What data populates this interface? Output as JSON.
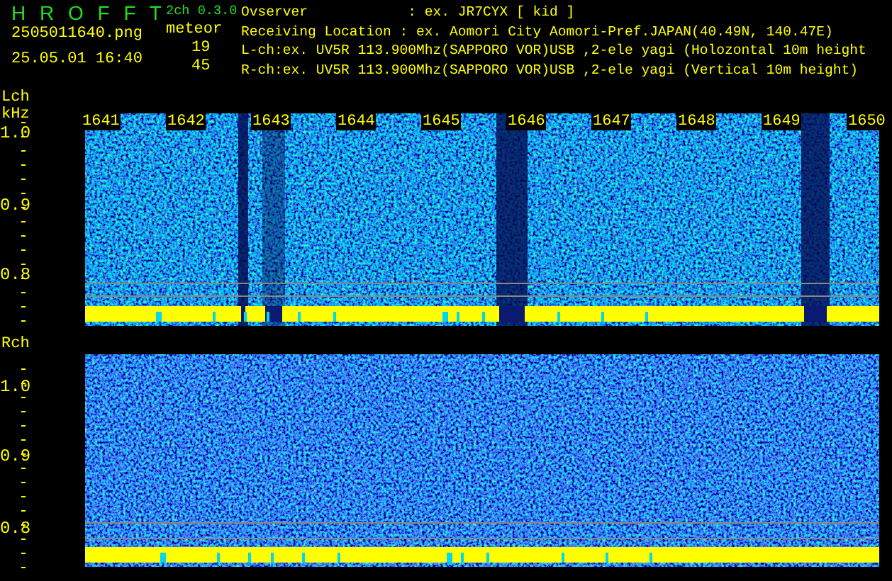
{
  "app": {
    "title": "H R O F F T",
    "version": "2ch 0.3.0"
  },
  "file": "2505011640.png",
  "timestamp": "25.05.01 16:40",
  "meteor": {
    "label": "meteor",
    "counts": [
      "19",
      "45"
    ]
  },
  "info": [
    "Ovserver            : ex. JR7CYX [ kid ]",
    "Receiving Location : ex. Aomori City Aomori-Pref.JAPAN(40.49N, 140.47E)",
    "L-ch:ex. UV5R 113.900Mhz(SAPPORO VOR)USB ,2-ele yagi (Holozontal 10m height",
    "R-ch:ex. UV5R 113.900Mhz(SAPPORO VOR)USB ,2-ele yagi (Vertical 10m height)"
  ],
  "channels": [
    {
      "name": "Lch",
      "unit": "kHz",
      "axis_labels": [
        "1.0",
        "0.9",
        "0.8"
      ],
      "time_labels": [
        "1641",
        "1642",
        "1643",
        "1644",
        "1645",
        "1646",
        "1647",
        "1648",
        "1649",
        "1650"
      ]
    },
    {
      "name": "Rch",
      "axis_labels": [
        "1.0",
        "0.9",
        "0.8"
      ]
    }
  ]
}
